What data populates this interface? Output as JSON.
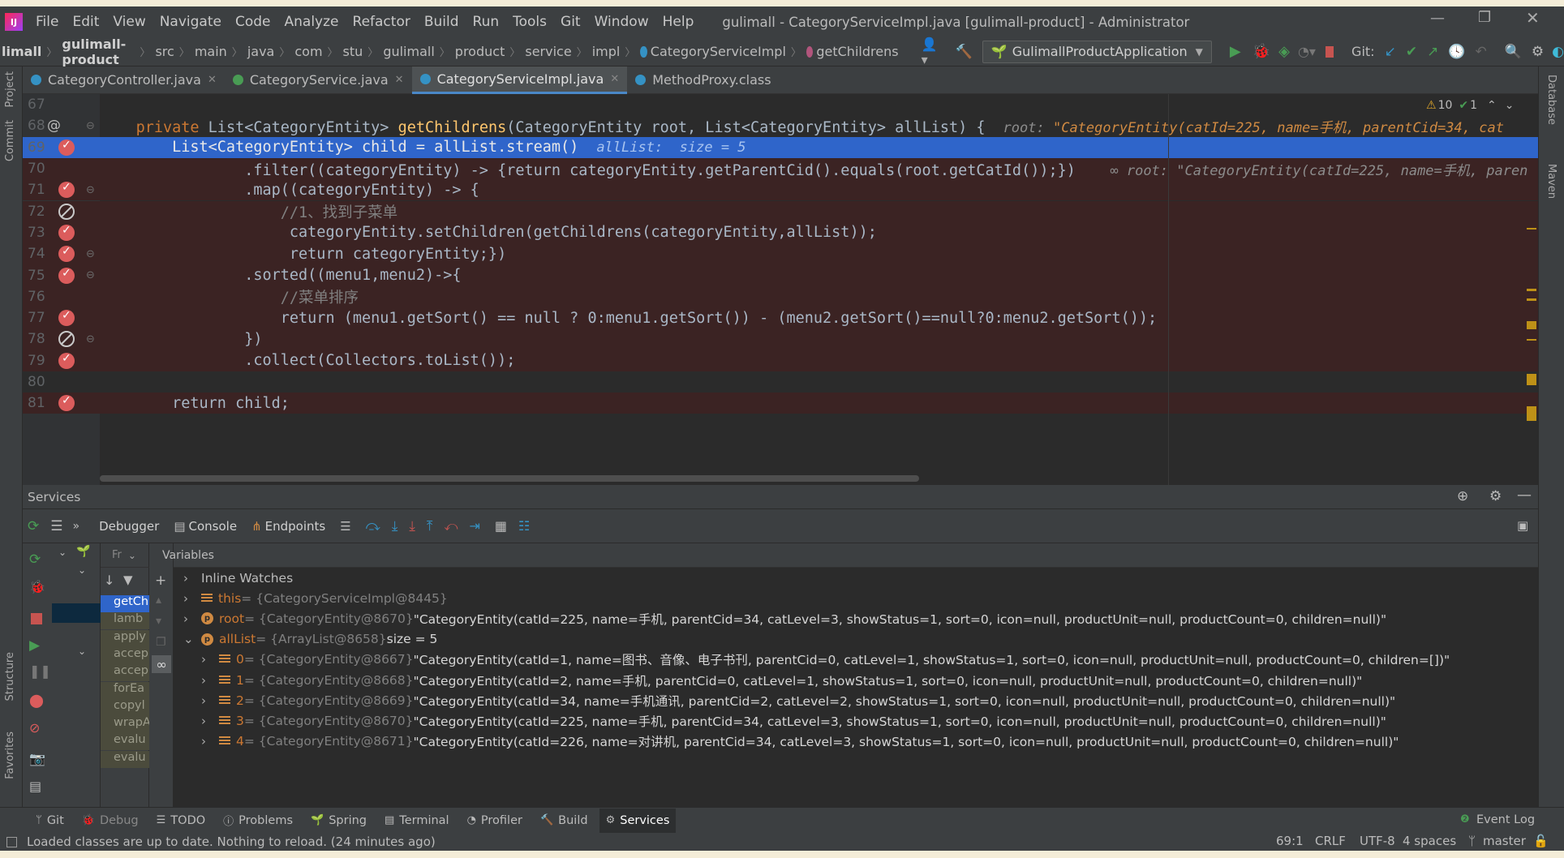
{
  "title": {
    "app_icon": "IJ",
    "menu": [
      "File",
      "Edit",
      "View",
      "Navigate",
      "Code",
      "Analyze",
      "Refactor",
      "Build",
      "Run",
      "Tools",
      "Git",
      "Window",
      "Help"
    ],
    "window_title": "gulimall - CategoryServiceImpl.java [gulimall-product] - Administrator"
  },
  "breadcrumb": [
    "limall",
    "gulimall-product",
    "src",
    "main",
    "java",
    "com",
    "stu",
    "gulimall",
    "product",
    "service",
    "impl",
    "CategoryServiceImpl",
    "getChildrens"
  ],
  "run_config": "GulimallProductApplication",
  "git_label": "Git:",
  "tabs": [
    {
      "label": "CategoryController.java",
      "active": false
    },
    {
      "label": "CategoryService.java",
      "active": false
    },
    {
      "label": "CategoryServiceImpl.java",
      "active": true
    },
    {
      "label": "MethodProxy.class",
      "active": false
    }
  ],
  "inspections": {
    "warnings": "10",
    "ok": "1"
  },
  "side_labels": {
    "project": "Project",
    "commit": "Commit",
    "structure": "Structure",
    "favorites": "Favorites",
    "database": "Database",
    "maven": "Maven"
  },
  "editor": {
    "lines": [
      {
        "num": "67",
        "bp": "",
        "code": ""
      },
      {
        "num": "68",
        "bp": "at",
        "code_pre": "    ",
        "kw": "private ",
        "type": "List<CategoryEntity> ",
        "fn": "getChildrens",
        "rest": "(CategoryEntity root, List<CategoryEntity> allList) {",
        "hint_label": "root: ",
        "hint_value": "\"CategoryEntity(catId=225, name=手机, parentCid=34, cat"
      },
      {
        "num": "69",
        "bp": "red",
        "code": "        List<CategoryEntity> child = allList.stream()",
        "hint_label": "allList:  size = 5"
      },
      {
        "num": "70",
        "bp": "",
        "code": "                .filter((categoryEntity) -> {return categoryEntity.getParentCid().equals(root.getCatId());})",
        "hint_label": "  ∞ root: \"CategoryEntity(catId=225, name=手机, paren"
      },
      {
        "num": "71",
        "bp": "red",
        "code": "                .map((categoryEntity) -> {"
      },
      {
        "num": "72",
        "bp": "dis",
        "code": "                    //1、找到子菜单"
      },
      {
        "num": "73",
        "bp": "red",
        "code": "                     categoryEntity.setChildren(getChildrens(categoryEntity,allList));"
      },
      {
        "num": "74",
        "bp": "red",
        "code": "                     return categoryEntity;})"
      },
      {
        "num": "75",
        "bp": "red",
        "code": "                .sorted((menu1,menu2)->{"
      },
      {
        "num": "76",
        "bp": "",
        "code": "                    //菜单排序"
      },
      {
        "num": "77",
        "bp": "red",
        "code": "                    return (menu1.getSort() == null ? 0:menu1.getSort()) - (menu2.getSort()==null?0:menu2.getSort());"
      },
      {
        "num": "78",
        "bp": "dis",
        "code": "                })"
      },
      {
        "num": "79",
        "bp": "red",
        "code": "                .collect(Collectors.toList());"
      },
      {
        "num": "80",
        "bp": "",
        "code": ""
      },
      {
        "num": "81",
        "bp": "red",
        "code": "        return child;"
      }
    ]
  },
  "services": {
    "title": "Services",
    "debugger_tab": "Debugger",
    "console_tab": "Console",
    "endpoints_tab": "Endpoints",
    "frames_label": "Fr",
    "variables_label": "Variables",
    "frames": [
      "getCh",
      "lamb",
      "apply",
      "accep",
      "accep",
      "forEa",
      "copyl",
      "wrapA",
      "evalu",
      "evalu"
    ],
    "vars": [
      {
        "indent": 0,
        "arrow": "›",
        "icon": "",
        "name": "Inline Watches",
        "ref": "",
        "value": ""
      },
      {
        "indent": 0,
        "arrow": "›",
        "icon": "list",
        "name": "this",
        "ref": " = {CategoryServiceImpl@8445}",
        "value": ""
      },
      {
        "indent": 0,
        "arrow": "›",
        "icon": "p",
        "name": "root",
        "ref": " = {CategoryEntity@8670}",
        "value": " \"CategoryEntity(catId=225, name=手机, parentCid=34, catLevel=3, showStatus=1, sort=0, icon=null, productUnit=null, productCount=0, children=null)\""
      },
      {
        "indent": 0,
        "arrow": "⌄",
        "icon": "p",
        "name": "allList",
        "ref": " = {ArrayList@8658}",
        "value": "  size = 5"
      },
      {
        "indent": 1,
        "arrow": "›",
        "icon": "list",
        "name": "0",
        "ref": " = {CategoryEntity@8667}",
        "value": " \"CategoryEntity(catId=1, name=图书、音像、电子书刊, parentCid=0, catLevel=1, showStatus=1, sort=0, icon=null, productUnit=null, productCount=0, children=[])\""
      },
      {
        "indent": 1,
        "arrow": "›",
        "icon": "list",
        "name": "1",
        "ref": " = {CategoryEntity@8668}",
        "value": " \"CategoryEntity(catId=2, name=手机, parentCid=0, catLevel=1, showStatus=1, sort=0, icon=null, productUnit=null, productCount=0, children=null)\""
      },
      {
        "indent": 1,
        "arrow": "›",
        "icon": "list",
        "name": "2",
        "ref": " = {CategoryEntity@8669}",
        "value": " \"CategoryEntity(catId=34, name=手机通讯, parentCid=2, catLevel=2, showStatus=1, sort=0, icon=null, productUnit=null, productCount=0, children=null)\""
      },
      {
        "indent": 1,
        "arrow": "›",
        "icon": "list",
        "name": "3",
        "ref": " = {CategoryEntity@8670}",
        "value": " \"CategoryEntity(catId=225, name=手机, parentCid=34, catLevel=3, showStatus=1, sort=0, icon=null, productUnit=null, productCount=0, children=null)\""
      },
      {
        "indent": 1,
        "arrow": "›",
        "icon": "list",
        "name": "4",
        "ref": " = {CategoryEntity@8671}",
        "value": " \"CategoryEntity(catId=226, name=对讲机, parentCid=34, catLevel=3, showStatus=1, sort=0, icon=null, productUnit=null, productCount=0, children=null)\""
      }
    ]
  },
  "bottom_tabs": [
    "Git",
    "Debug",
    "TODO",
    "Problems",
    "Spring",
    "Terminal",
    "Profiler",
    "Build",
    "Services"
  ],
  "event_log": "Event Log",
  "status": {
    "message": "Loaded classes are up to date. Nothing to reload. (24 minutes ago)",
    "position": "69:1",
    "line_sep": "CRLF",
    "encoding": "UTF-8",
    "indent": "4 spaces",
    "branch": "master"
  },
  "colors": {
    "accent": "#4a88c7",
    "breakpoint": "#db5c5c",
    "exec_line": "#2f65ca",
    "bp_line": "#3b2323"
  }
}
